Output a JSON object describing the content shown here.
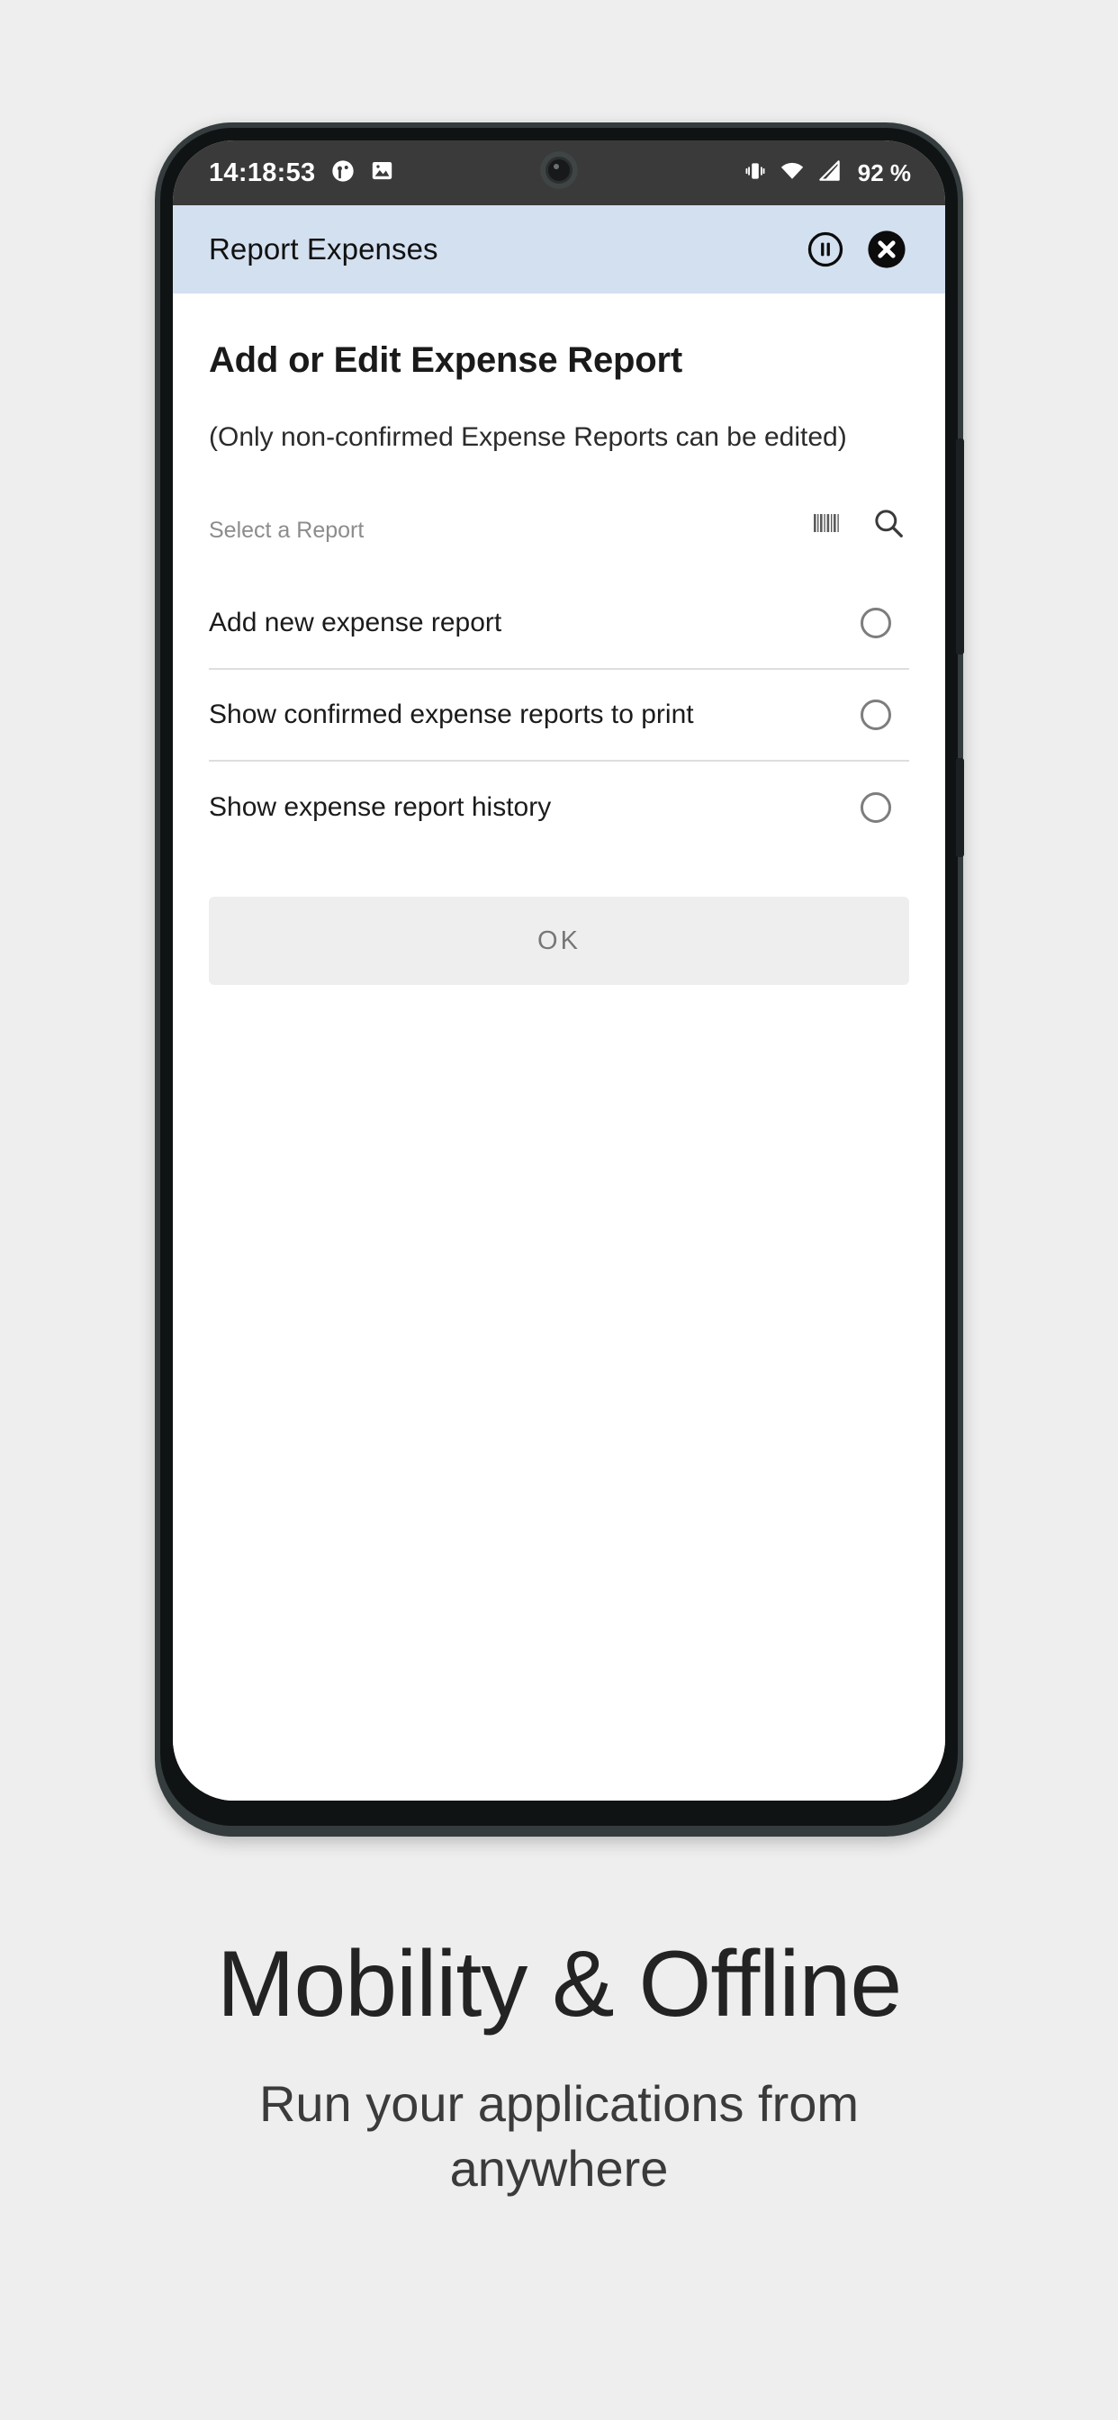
{
  "status_bar": {
    "clock": "14:18:53",
    "battery": "92 %",
    "icons_left": [
      "notification-circle-icon",
      "image-icon"
    ],
    "icons_right": [
      "vibrate-icon",
      "wifi-icon",
      "cellular-signal-icon"
    ],
    "background_color": "#3a3a3a"
  },
  "app_bar": {
    "title": "Report Expenses",
    "background_color": "#d3e0f0",
    "actions": [
      {
        "name": "pause-circle-icon"
      },
      {
        "name": "close-circle-icon"
      }
    ]
  },
  "screen": {
    "page_title": "Add or Edit Expense Report",
    "page_subtitle": "(Only non-confirmed Expense Reports can be edited)",
    "select_field": {
      "value": "",
      "placeholder": "Select a Report",
      "actions": [
        "barcode-scan-icon",
        "search-icon"
      ]
    },
    "options": [
      {
        "label": "Add new expense report",
        "selected": false
      },
      {
        "label": "Show confirmed expense reports to print",
        "selected": false
      },
      {
        "label": "Show expense report history",
        "selected": false
      }
    ],
    "ok_button": "OK"
  },
  "caption": {
    "headline": "Mobility & Offline",
    "subhead": "Run your applications from anywhere"
  }
}
